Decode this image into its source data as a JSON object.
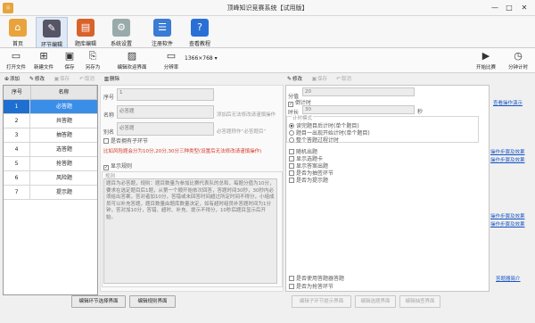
{
  "window": {
    "title": "顶峰知识竞赛系统【试用版】",
    "minimize": "—",
    "maximize": "□",
    "close": "✕"
  },
  "ribbon": [
    {
      "label": "首页",
      "icon": "⌂",
      "color": "#e8a33c"
    },
    {
      "label": "环节编辑",
      "icon": "✎",
      "color": "#556"
    },
    {
      "label": "题库编辑",
      "icon": "▤",
      "color": "#d9622b"
    },
    {
      "label": "系统设置",
      "icon": "⚙",
      "color": "#9aa"
    },
    {
      "label": "注册软件",
      "icon": "☰",
      "color": "#3a7bd5"
    },
    {
      "label": "查看教程",
      "icon": "?",
      "color": "#2a6fd6"
    }
  ],
  "toolbar": {
    "open": "打开文件",
    "new": "新建文件",
    "save": "保存",
    "saveas": "另存为",
    "edit_welcome": "编辑欢迎界面",
    "resolution_value": "1366×768",
    "resolution_label": "分辨率",
    "start": "开始比赛",
    "timer": "分钟计时"
  },
  "left_actions": {
    "add": "添加",
    "modify": "修改",
    "save": "保存",
    "cancel": "取消",
    "delete": "删除"
  },
  "right_actions": {
    "modify": "修改",
    "save": "保存",
    "cancel": "取消"
  },
  "list": {
    "headers": [
      "序号",
      "名称"
    ],
    "rows": [
      {
        "no": "1",
        "name": "必答题"
      },
      {
        "no": "2",
        "name": "共答题"
      },
      {
        "no": "3",
        "name": "抽答题"
      },
      {
        "no": "4",
        "name": "选答题"
      },
      {
        "no": "5",
        "name": "抢答题"
      },
      {
        "no": "6",
        "name": "风险题"
      },
      {
        "no": "7",
        "name": "提示题"
      }
    ]
  },
  "edit": {
    "no_label": "序号",
    "no_value": "1",
    "name_label": "名称",
    "name_value": "必答题",
    "name_hint": "添加后无法修改请谨慎操作",
    "alias_label": "别名",
    "alias_value": "必答题",
    "alias_hint": "必答题称作“必答题目”",
    "has_group_label": "是否拥有子环节",
    "score_hint": "比如风险题会分为10分,20分,30分三种类型(设置后无法修改请谨慎操作)",
    "show_rules_label": "显示规则",
    "rules_label": "规则",
    "rules_text": "题目为必答题，规则：题目数量为参加比赛代表队的总和，每题分值为10分，要求在选定题目后1题，从第一个顺开始依次回答，答题时间30秒，30秒内必须给出答案，答对者加10分，答错或未回答时间超过所定时间不得分，小组成员可以补充答题，题目数量由题库数量决定，如有超时组员补答题时间为1分钟，答对加10分，答错、超时、补充、提示不得分，10秒后题目显示后开始。"
  },
  "settings": {
    "score_label": "分值",
    "score_value": "20",
    "countdown_label": "倒计时",
    "time_label": "时长",
    "time_value": "30",
    "time_unit": "秒",
    "timer_mode_label": "计时模式",
    "mode1": "读完题目后计时(单个题目)",
    "mode2": "题目一出现开始计时(单个题目)",
    "mode3": "整个答题过程计时",
    "opt_random": "随机出题",
    "opt_show_option": "显示选题卡",
    "opt_show_answer": "显示答案出题",
    "opt_draw": "是否为抽签环节",
    "opt_hint": "是否为提示题",
    "opt_use_answer": "是否使用答题器答题",
    "opt_lottery": "是否为抢答环节"
  },
  "links": {
    "edit_op": "查看操作演示",
    "op_effect1": "操作步骤及效果",
    "op_effect2": "操作步骤及效果",
    "op_effect3": "操作步骤及效果",
    "op_effect4": "操作步骤及效果",
    "answer_intro": "答题器简介"
  },
  "buttons": {
    "edit_sub_select": "编辑环节选择界面",
    "edit_rules": "编辑规则界面",
    "edit_sub_hint": "编辑子环节提示界面",
    "edit_select": "编辑选题界面",
    "edit_draw": "编辑抽签界面"
  }
}
